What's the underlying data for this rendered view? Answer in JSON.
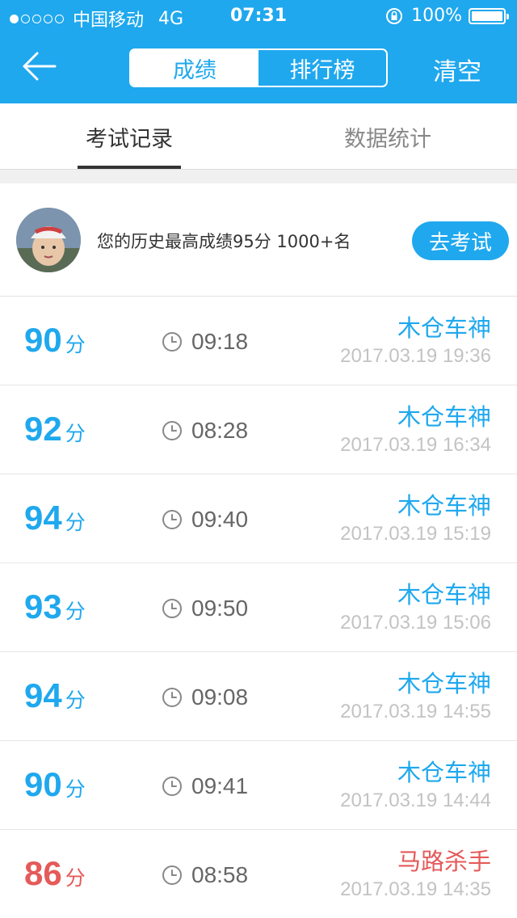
{
  "status_bar": {
    "carrier": "中国移动",
    "network": "4G",
    "time": "07:31",
    "battery": "100%",
    "signal_bars": 1,
    "signal_total": 5
  },
  "header": {
    "back_icon": "arrow-left-icon",
    "segments": [
      {
        "label": "成绩",
        "active": true
      },
      {
        "label": "排行榜",
        "active": false
      }
    ],
    "clear_label": "清空"
  },
  "tabs": [
    {
      "label": "考试记录",
      "active": true
    },
    {
      "label": "数据统计",
      "active": false
    }
  ],
  "profile": {
    "best_text": "您的历史最高成绩95分  1000+名",
    "exam_button": "去考试"
  },
  "records": [
    {
      "score": "90",
      "unit": "分",
      "duration": "09:18",
      "nickname": "木仓车神",
      "datetime": "2017.03.19 19:36",
      "color": "#1fa8ee"
    },
    {
      "score": "92",
      "unit": "分",
      "duration": "08:28",
      "nickname": "木仓车神",
      "datetime": "2017.03.19 16:34",
      "color": "#1fa8ee"
    },
    {
      "score": "94",
      "unit": "分",
      "duration": "09:40",
      "nickname": "木仓车神",
      "datetime": "2017.03.19 15:19",
      "color": "#1fa8ee"
    },
    {
      "score": "93",
      "unit": "分",
      "duration": "09:50",
      "nickname": "木仓车神",
      "datetime": "2017.03.19 15:06",
      "color": "#1fa8ee"
    },
    {
      "score": "94",
      "unit": "分",
      "duration": "09:08",
      "nickname": "木仓车神",
      "datetime": "2017.03.19 14:55",
      "color": "#1fa8ee"
    },
    {
      "score": "90",
      "unit": "分",
      "duration": "09:41",
      "nickname": "木仓车神",
      "datetime": "2017.03.19 14:44",
      "color": "#1fa8ee"
    },
    {
      "score": "86",
      "unit": "分",
      "duration": "08:58",
      "nickname": "马路杀手",
      "datetime": "2017.03.19 14:35",
      "color": "#e55a5a"
    }
  ],
  "colors": {
    "accent": "#1fa8ee",
    "fail": "#e55a5a"
  }
}
